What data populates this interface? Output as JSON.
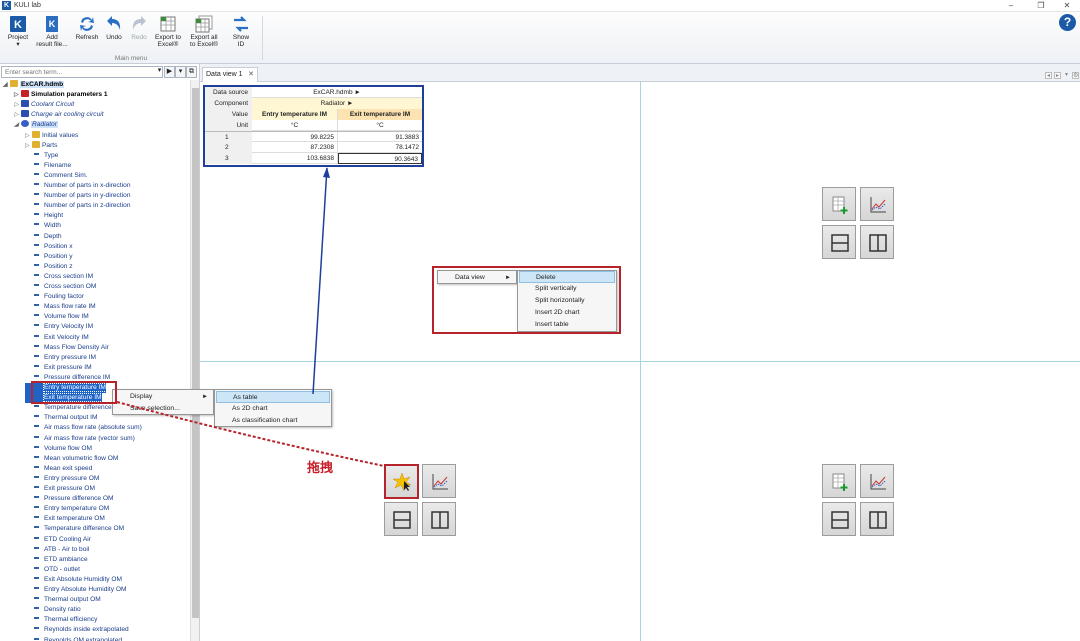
{
  "window": {
    "title": "KULI lab",
    "logo_letter": "K",
    "minimize": "–",
    "maximize": "❐",
    "close": "✕"
  },
  "ribbon": {
    "buttons": [
      {
        "label": "Project\n▾",
        "icon": "project-icon"
      },
      {
        "label": "Add\nresult file...",
        "icon": "add-result-file-icon"
      },
      {
        "label": "Refresh",
        "icon": "refresh-icon"
      },
      {
        "label": "Undo",
        "icon": "undo-icon"
      },
      {
        "label": "Redo",
        "icon": "redo-icon"
      },
      {
        "label": "Export to\nExcel®",
        "icon": "export-excel-icon"
      },
      {
        "label": "Export all\nto Excel®",
        "icon": "export-all-excel-icon"
      },
      {
        "label": "Show\nID",
        "icon": "show-id-icon"
      }
    ],
    "group_label": "Main menu",
    "help": "?"
  },
  "sidebar": {
    "search_placeholder": "Enter search term...",
    "btn_dropdown": "▾",
    "btn_go": "▶",
    "btn_collapse": "▾",
    "btn_window": "⧉",
    "tree": [
      {
        "label": "ExCAR.hdmb",
        "level": 0,
        "expander": "◢",
        "icon": "folder",
        "style": "bold-sel"
      },
      {
        "label": "Simulation parameters 1",
        "level": 1,
        "expander": "▷",
        "icon": "red",
        "style": "bold"
      },
      {
        "label": "Coolant Circuit",
        "level": 1,
        "expander": "▷",
        "icon": "blue",
        "style": "ital"
      },
      {
        "label": "Charge air cooling circuit",
        "level": 1,
        "expander": "▷",
        "icon": "blue",
        "style": "ital"
      },
      {
        "label": "Radiator",
        "level": 1,
        "expander": "◢",
        "icon": "circle",
        "style": "ital-sel"
      },
      {
        "label": "Initial values",
        "level": 2,
        "expander": "▷",
        "icon": "folder-y"
      },
      {
        "label": "Parts",
        "level": 2,
        "expander": "▷",
        "icon": "folder-y"
      },
      {
        "label": "Type",
        "level": 2
      },
      {
        "label": "Filename",
        "level": 2
      },
      {
        "label": "Comment Sim.",
        "level": 2
      },
      {
        "label": "Number of parts in x-direction",
        "level": 2
      },
      {
        "label": "Number of parts in y-direction",
        "level": 2
      },
      {
        "label": "Number of parts in z-direction",
        "level": 2
      },
      {
        "label": "Height",
        "level": 2
      },
      {
        "label": "Width",
        "level": 2
      },
      {
        "label": "Depth",
        "level": 2
      },
      {
        "label": "Position x",
        "level": 2
      },
      {
        "label": "Position y",
        "level": 2
      },
      {
        "label": "Position z",
        "level": 2
      },
      {
        "label": "Cross section IM",
        "level": 2
      },
      {
        "label": "Cross section OM",
        "level": 2
      },
      {
        "label": "Fouling factor",
        "level": 2
      },
      {
        "label": "Mass flow rate IM",
        "level": 2
      },
      {
        "label": "Volume flow IM",
        "level": 2
      },
      {
        "label": "Entry Velocity IM",
        "level": 2
      },
      {
        "label": "Exit Velocity IM",
        "level": 2
      },
      {
        "label": "Mass Flow Density Air",
        "level": 2
      },
      {
        "label": "Entry pressure IM",
        "level": 2
      },
      {
        "label": "Exit pressure IM",
        "level": 2
      },
      {
        "label": "Pressure difference IM",
        "level": 2
      },
      {
        "label": "Entry temperature IM",
        "level": 2,
        "style": "sel"
      },
      {
        "label": "Exit temperature IM",
        "level": 2,
        "style": "sel"
      },
      {
        "label": "Temperature difference",
        "level": 2
      },
      {
        "label": "Thermal output IM",
        "level": 2
      },
      {
        "label": "Air mass flow rate (absolute sum)",
        "level": 2
      },
      {
        "label": "Air mass flow rate (vector sum)",
        "level": 2
      },
      {
        "label": "Volume flow OM",
        "level": 2
      },
      {
        "label": "Mean volumetric flow OM",
        "level": 2
      },
      {
        "label": "Mean exit speed",
        "level": 2
      },
      {
        "label": "Entry pressure OM",
        "level": 2
      },
      {
        "label": "Exit pressure OM",
        "level": 2
      },
      {
        "label": "Pressure difference OM",
        "level": 2
      },
      {
        "label": "Entry temperature OM",
        "level": 2
      },
      {
        "label": "Exit temperature OM",
        "level": 2
      },
      {
        "label": "Temperature difference OM",
        "level": 2
      },
      {
        "label": "ETD Cooling Air",
        "level": 2
      },
      {
        "label": "ATB - Air to boil",
        "level": 2
      },
      {
        "label": "ETD ambiance",
        "level": 2
      },
      {
        "label": "OTD - outlet",
        "level": 2
      },
      {
        "label": "Exit Absolute Humidity OM",
        "level": 2
      },
      {
        "label": "Entry Absolute Humidity OM",
        "level": 2
      },
      {
        "label": "Thermal output OM",
        "level": 2
      },
      {
        "label": "Density ratio",
        "level": 2
      },
      {
        "label": "Thermal efficiency",
        "level": 2
      },
      {
        "label": "Reynolds inside extrapolated",
        "level": 2
      },
      {
        "label": "Reynolds OM extrapolated",
        "level": 2
      }
    ]
  },
  "tabs": [
    {
      "label": "Data view 1",
      "close": "✕"
    }
  ],
  "tab_nav": {
    "prev": "◂",
    "next": "▸",
    "menu": "▾"
  },
  "data_table": {
    "source_label": "Data source",
    "source_value": "ExCAR.hdmb ►",
    "component_label": "Component",
    "component_value": "Radiator ►",
    "value_label": "Value",
    "unit_label": "Unit",
    "columns": [
      "Entry temperature IM",
      "Exit temperature IM"
    ],
    "units": [
      "°C",
      "°C"
    ],
    "rows": [
      {
        "index": "1",
        "values": [
          "99.8225",
          "91.3883"
        ]
      },
      {
        "index": "2",
        "values": [
          "87.2308",
          "78.1472"
        ]
      },
      {
        "index": "3",
        "values": [
          "103.6838",
          "90.3643"
        ]
      }
    ]
  },
  "display_menu": {
    "items": [
      {
        "label": "Display",
        "arrow": "►"
      },
      {
        "label": "Save selection..."
      }
    ],
    "submenu": [
      "As table",
      "As 2D chart",
      "As classification chart"
    ]
  },
  "data_view_menu": {
    "item": {
      "label": "Data view",
      "arrow": "►"
    },
    "submenu": [
      "Delete",
      "Split vertically",
      "Split horizontally",
      "Insert 2D chart",
      "Insert table"
    ]
  },
  "annotation": {
    "drag_label": "拖拽"
  },
  "colors": {
    "annotation_red": "#b6232a",
    "annotation_blue": "#1f3f9a",
    "selection": "#1e64c8",
    "splitter": "#a8d4df"
  }
}
